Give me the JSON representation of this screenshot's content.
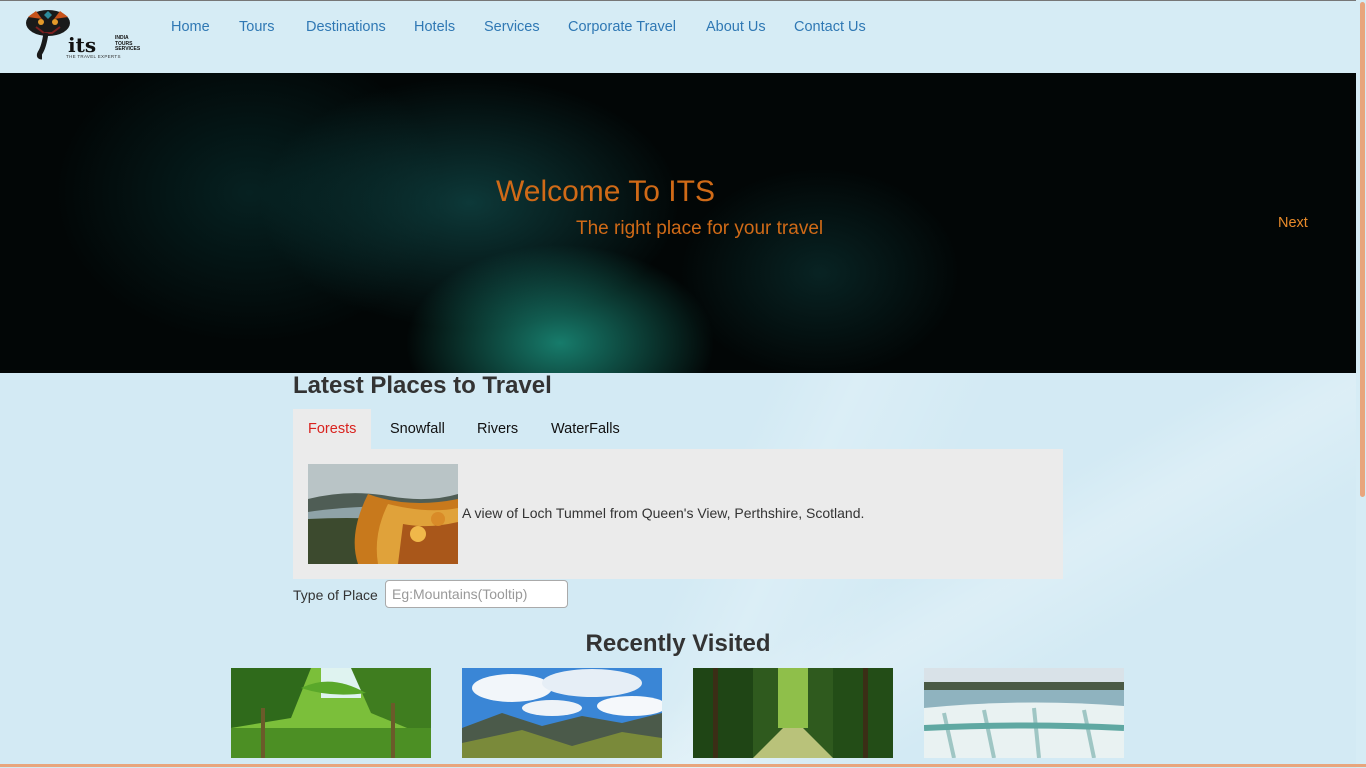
{
  "logo": {
    "brand": "its",
    "brand_sub": [
      "INDIA",
      "TOURS",
      "SERVICES"
    ],
    "tagline": "THE TRAVEL EXPERTS"
  },
  "nav": [
    {
      "label": "Home"
    },
    {
      "label": "Tours"
    },
    {
      "label": "Destinations"
    },
    {
      "label": "Hotels"
    },
    {
      "label": "Services"
    },
    {
      "label": "Corporate Travel"
    },
    {
      "label": "About Us"
    },
    {
      "label": "Contact Us"
    }
  ],
  "hero": {
    "title": "Welcome To ITS",
    "subtitle": "The right place for your travel",
    "next_label": "Next"
  },
  "latest": {
    "title": "Latest Places to Travel",
    "tabs": [
      {
        "label": "Forests"
      },
      {
        "label": "Snowfall"
      },
      {
        "label": "Rivers"
      },
      {
        "label": "WaterFalls"
      }
    ],
    "active_tab": "Forests",
    "caption": "A view of Loch Tummel from Queen's View, Perthshire, Scotland."
  },
  "search": {
    "label": "Type of Place",
    "placeholder": "Eg:Mountains(Tooltip)",
    "value": ""
  },
  "recent": {
    "title": "Recently Visited"
  },
  "colors": {
    "page_bg": "#d3eaf4",
    "accent_orange": "#d06a17",
    "nav_link": "#2f78b4",
    "active_tab_text": "#d9231f"
  }
}
